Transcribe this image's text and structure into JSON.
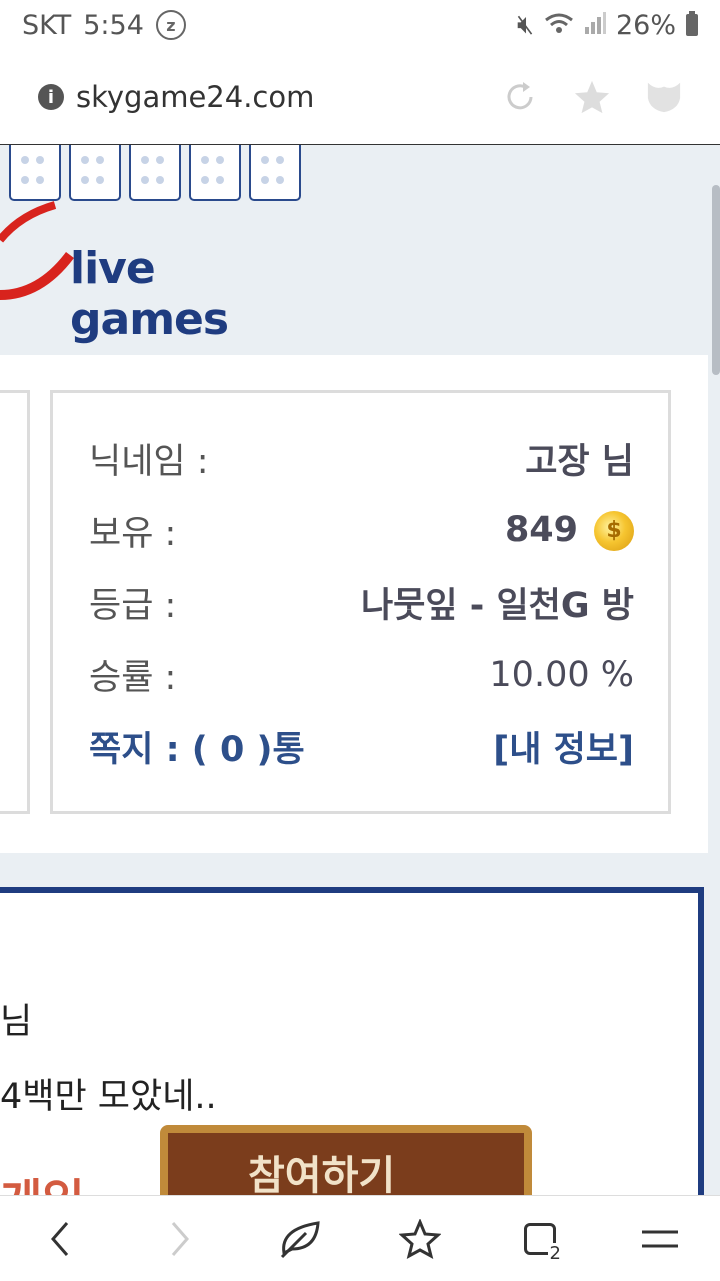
{
  "status_bar": {
    "carrier": "SKT",
    "time": "5:54",
    "badge": "z",
    "battery": "26%"
  },
  "browser": {
    "url": "skygame24.com",
    "icons": [
      "info-icon",
      "reload-icon",
      "star-icon",
      "shield-icon"
    ]
  },
  "logo": {
    "text": "live games"
  },
  "user_info": {
    "nickname_label": "닉네임 :",
    "nickname_value": "고장 님",
    "holdings_label": "보유 :",
    "holdings_value": "849",
    "coin_symbol": "$",
    "grade_label": "등급 :",
    "grade_value": "나뭇잎 - 일천G 방",
    "winrate_label": "승률 :",
    "winrate_value": "10.00 %",
    "messages": "쪽지 : ( 0 )통",
    "my_info_link": "[내 정보]"
  },
  "event_panel": {
    "line1": "님",
    "line2": "4백만 모았네..",
    "button_text": "참여하기",
    "ribbon_text": "게임"
  },
  "bottom_bar": {
    "tab_count": "2",
    "icons": [
      "back-icon",
      "forward-icon",
      "home-icon",
      "bookmark-icon",
      "tabs-icon",
      "menu-icon"
    ]
  },
  "colors": {
    "accent_blue": "#1f3c80",
    "message_blue": "#2d4f8a",
    "coin_gold": "#f6c530"
  }
}
